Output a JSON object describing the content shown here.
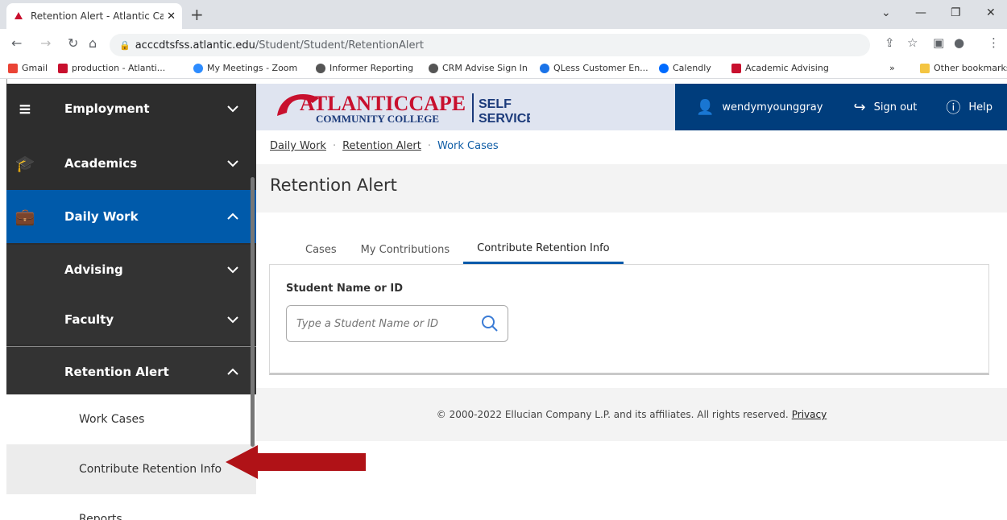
{
  "browser": {
    "tab_title": "Retention Alert - Atlantic Cape Se",
    "url_host": "acccdtsfss.atlantic.edu",
    "url_path": "/Student/Student/RetentionAlert",
    "bookmarks": [
      {
        "label": "Gmail",
        "color": "#ea4335"
      },
      {
        "label": "production - Atlanti...",
        "color": "#c8102e"
      },
      {
        "label": "My Meetings - Zoom",
        "color": "#2d8cff"
      },
      {
        "label": "Informer Reporting",
        "color": "#555555"
      },
      {
        "label": "CRM Advise Sign In",
        "color": "#555555"
      },
      {
        "label": "QLess Customer En...",
        "color": "#1a73e8"
      },
      {
        "label": "Calendly",
        "color": "#006bff"
      },
      {
        "label": "Academic Advising",
        "color": "#c8102e"
      }
    ],
    "more_bookmarks": "»",
    "other_bookmarks": "Other bookmarks"
  },
  "sidebar": {
    "employment": "Employment",
    "academics": "Academics",
    "daily_work": "Daily Work",
    "advising": "Advising",
    "faculty": "Faculty",
    "retention_alert": "Retention Alert",
    "work_cases": "Work Cases",
    "contribute_retention_info": "Contribute Retention Info",
    "reports": "Reports"
  },
  "header": {
    "logo_atlantic": "ATLANTICCAPE",
    "logo_college": "COMMUNITY COLLEGE",
    "logo_self": "SELF",
    "logo_service": "SERVICE",
    "user": "wendymyounggray",
    "sign_out": "Sign out",
    "help": "Help"
  },
  "breadcrumb": {
    "daily_work": "Daily Work",
    "retention_alert": "Retention Alert",
    "work_cases": "Work Cases"
  },
  "page_title": "Retention Alert",
  "tabs": [
    "Cases",
    "My Contributions",
    "Contribute Retention Info"
  ],
  "form": {
    "label": "Student Name or ID",
    "placeholder": "Type a Student Name or ID"
  },
  "footer": {
    "text": "© 2000-2022 Ellucian Company L.P. and its affiliates. All rights reserved.",
    "privacy": "Privacy"
  },
  "colors": {
    "sidebar_bg": "#2d2d2d",
    "active_blue": "#005aaa",
    "header_blue": "#003d7c",
    "brand_red": "#c8102e",
    "arrow_red": "#b01217"
  }
}
